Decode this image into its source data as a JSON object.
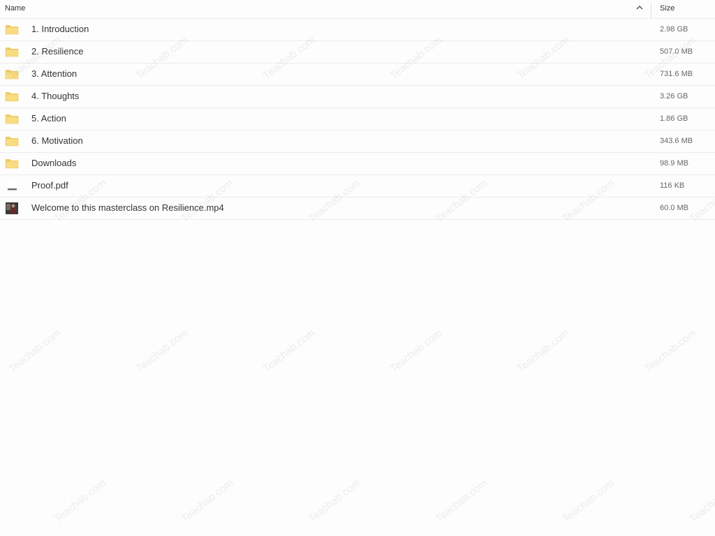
{
  "header": {
    "name_label": "Name",
    "size_label": "Size",
    "sort_icon": "chevron-up-icon"
  },
  "files": [
    {
      "name": "1. Introduction",
      "size": "2.98 GB",
      "type": "folder",
      "icon": "folder-icon"
    },
    {
      "name": "2. Resilience",
      "size": "507.0 MB",
      "type": "folder",
      "icon": "folder-icon"
    },
    {
      "name": "3. Attention",
      "size": "731.6 MB",
      "type": "folder",
      "icon": "folder-icon"
    },
    {
      "name": "4. Thoughts",
      "size": "3.26 GB",
      "type": "folder",
      "icon": "folder-icon"
    },
    {
      "name": "5. Action",
      "size": "1.86 GB",
      "type": "folder",
      "icon": "folder-icon"
    },
    {
      "name": "6. Motivation",
      "size": "343.6 MB",
      "type": "folder",
      "icon": "folder-icon"
    },
    {
      "name": "Downloads",
      "size": "98.9 MB",
      "type": "folder",
      "icon": "folder-icon"
    },
    {
      "name": "Proof.pdf",
      "size": "116 KB",
      "type": "pdf",
      "icon": "pdf-file-icon"
    },
    {
      "name": "Welcome to this masterclass on Resilience.mp4",
      "size": "60.0 MB",
      "type": "video",
      "icon": "video-thumbnail-icon"
    }
  ],
  "watermark": {
    "text": "Teachab.com"
  },
  "colors": {
    "folder_fill": "#f9dc7f",
    "folder_tab": "#f3c95a",
    "row_border": "#ececec"
  }
}
